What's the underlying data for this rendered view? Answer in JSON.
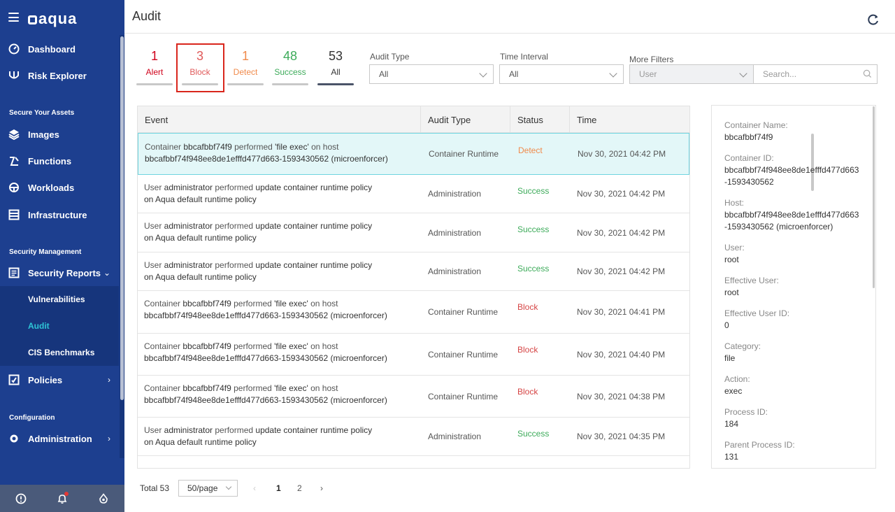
{
  "app": {
    "logo_text": "aqua"
  },
  "sidebar": {
    "top_items": [
      {
        "label": "Dashboard",
        "icon": "dashboard-icon"
      },
      {
        "label": "Risk Explorer",
        "icon": "risk-explorer-icon"
      }
    ],
    "sections": {
      "assets": "Secure Your Assets",
      "security": "Security Management",
      "config": "Configuration"
    },
    "asset_items": [
      {
        "label": "Images",
        "icon": "layers-icon"
      },
      {
        "label": "Functions",
        "icon": "functions-icon"
      },
      {
        "label": "Workloads",
        "icon": "workloads-icon"
      },
      {
        "label": "Infrastructure",
        "icon": "infrastructure-icon"
      }
    ],
    "security_reports": "Security Reports",
    "sub_items": [
      "Vulnerabilities",
      "Audit",
      "CIS Benchmarks"
    ],
    "policies": "Policies",
    "administration": "Administration"
  },
  "header": {
    "title": "Audit"
  },
  "stats": [
    {
      "count": "1",
      "label": "Alert"
    },
    {
      "count": "3",
      "label": "Block"
    },
    {
      "count": "1",
      "label": "Detect"
    },
    {
      "count": "48",
      "label": "Success"
    },
    {
      "count": "53",
      "label": "All"
    }
  ],
  "filters": {
    "audit_type_label": "Audit Type",
    "audit_type_value": "All",
    "time_interval_label": "Time Interval",
    "time_interval_value": "All",
    "more_filters_label": "More Filters",
    "more_filters_value": "User",
    "search_placeholder": "Search..."
  },
  "table": {
    "columns": [
      "Event",
      "Audit Type",
      "Status",
      "Time"
    ],
    "rows": [
      {
        "prefix": "Container ",
        "bold": "bbcafbbf74f9",
        "mid": " performed ",
        "bold2": "'file exec'",
        "mid2": " on host",
        "line2": "bbcafbbf74f948ee8de1efffd477d663-1593430562 (microenforcer)",
        "type": "Container Runtime",
        "status": "Detect",
        "time": "Nov 30, 2021 04:42 PM"
      },
      {
        "prefix": "User ",
        "bold": "administrator",
        "mid": " performed ",
        "bold2": "update container runtime policy",
        "mid2": "",
        "line2": " on  Aqua default runtime policy",
        "type": "Administration",
        "status": "Success",
        "time": "Nov 30, 2021 04:42 PM"
      },
      {
        "prefix": "User ",
        "bold": "administrator",
        "mid": " performed ",
        "bold2": "update container runtime policy",
        "mid2": "",
        "line2": " on  Aqua default runtime policy",
        "type": "Administration",
        "status": "Success",
        "time": "Nov 30, 2021 04:42 PM"
      },
      {
        "prefix": "User ",
        "bold": "administrator",
        "mid": " performed ",
        "bold2": "update container runtime policy",
        "mid2": "",
        "line2": " on  Aqua default runtime policy",
        "type": "Administration",
        "status": "Success",
        "time": "Nov 30, 2021 04:42 PM"
      },
      {
        "prefix": "Container ",
        "bold": "bbcafbbf74f9",
        "mid": " performed ",
        "bold2": "'file exec'",
        "mid2": " on host",
        "line2": "bbcafbbf74f948ee8de1efffd477d663-1593430562 (microenforcer)",
        "type": "Container Runtime",
        "status": "Block",
        "time": "Nov 30, 2021 04:41 PM"
      },
      {
        "prefix": "Container ",
        "bold": "bbcafbbf74f9",
        "mid": " performed ",
        "bold2": "'file exec'",
        "mid2": " on host",
        "line2": "bbcafbbf74f948ee8de1efffd477d663-1593430562 (microenforcer)",
        "type": "Container Runtime",
        "status": "Block",
        "time": "Nov 30, 2021 04:40 PM"
      },
      {
        "prefix": "Container ",
        "bold": "bbcafbbf74f9",
        "mid": " performed ",
        "bold2": "'file exec'",
        "mid2": " on host",
        "line2": "bbcafbbf74f948ee8de1efffd477d663-1593430562 (microenforcer)",
        "type": "Container Runtime",
        "status": "Block",
        "time": "Nov 30, 2021 04:38 PM"
      },
      {
        "prefix": "User ",
        "bold": "administrator",
        "mid": " performed ",
        "bold2": "update container runtime policy",
        "mid2": "",
        "line2": " on  Aqua default runtime policy",
        "type": "Administration",
        "status": "Success",
        "time": "Nov 30, 2021 04:35 PM"
      }
    ]
  },
  "details": [
    {
      "label": "Container Name:",
      "value": "bbcafbbf74f9"
    },
    {
      "label": "Container ID:",
      "value": "bbcafbbf74f948ee8de1efffd477d663-1593430562"
    },
    {
      "label": "Host:",
      "value": "bbcafbbf74f948ee8de1efffd477d663-1593430562 (microenforcer)"
    },
    {
      "label": "User:",
      "value": "root"
    },
    {
      "label": "Effective User:",
      "value": "root"
    },
    {
      "label": "Effective User ID:",
      "value": "0"
    },
    {
      "label": "Category:",
      "value": "file"
    },
    {
      "label": "Action:",
      "value": "exec"
    },
    {
      "label": "Process ID:",
      "value": "184"
    },
    {
      "label": "Parent Process ID:",
      "value": "131"
    }
  ],
  "pagination": {
    "total": "Total 53",
    "page_size": "50/page",
    "pages": [
      "1",
      "2"
    ]
  },
  "colors": {
    "sidebar": "#1d3f8f",
    "active_nav": "#2ec4d6",
    "block": "#d64545",
    "detect": "#f08a4b",
    "success": "#3dab5a",
    "highlight": "#d9261c"
  }
}
